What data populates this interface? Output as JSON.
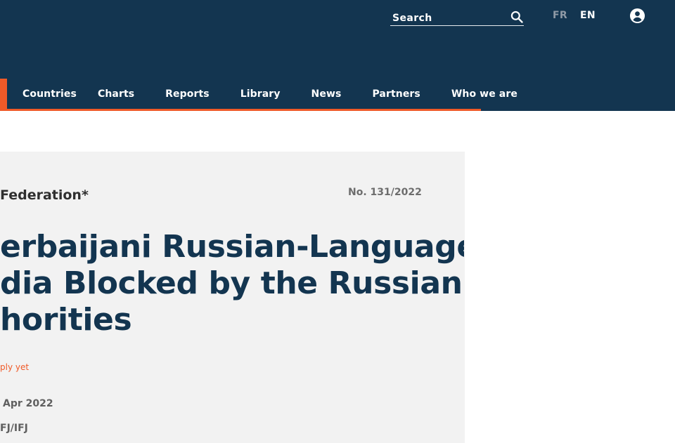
{
  "header": {
    "search": {
      "placeholder": "Search",
      "value": ""
    },
    "languages": {
      "fr": "FR",
      "en": "EN"
    },
    "icons": {
      "search": "search-icon",
      "user": "user-icon"
    }
  },
  "nav": {
    "items": [
      "Countries",
      "Charts",
      "Reports",
      "Library",
      "News",
      "Partners",
      "Who we are"
    ]
  },
  "alert": {
    "country_label": "Federation*",
    "number": "No. 131/2022",
    "title_lines": [
      "erbaijani Russian-Language",
      "dia Blocked by the Russian",
      "horities"
    ],
    "reply": "ply yet",
    "date": "Apr 2022",
    "partners": "FJ/IFJ"
  },
  "colors": {
    "header_bg": "#133550",
    "accent": "#f05a28",
    "card_bg": "#f2f2f2",
    "title_color": "#133550"
  }
}
